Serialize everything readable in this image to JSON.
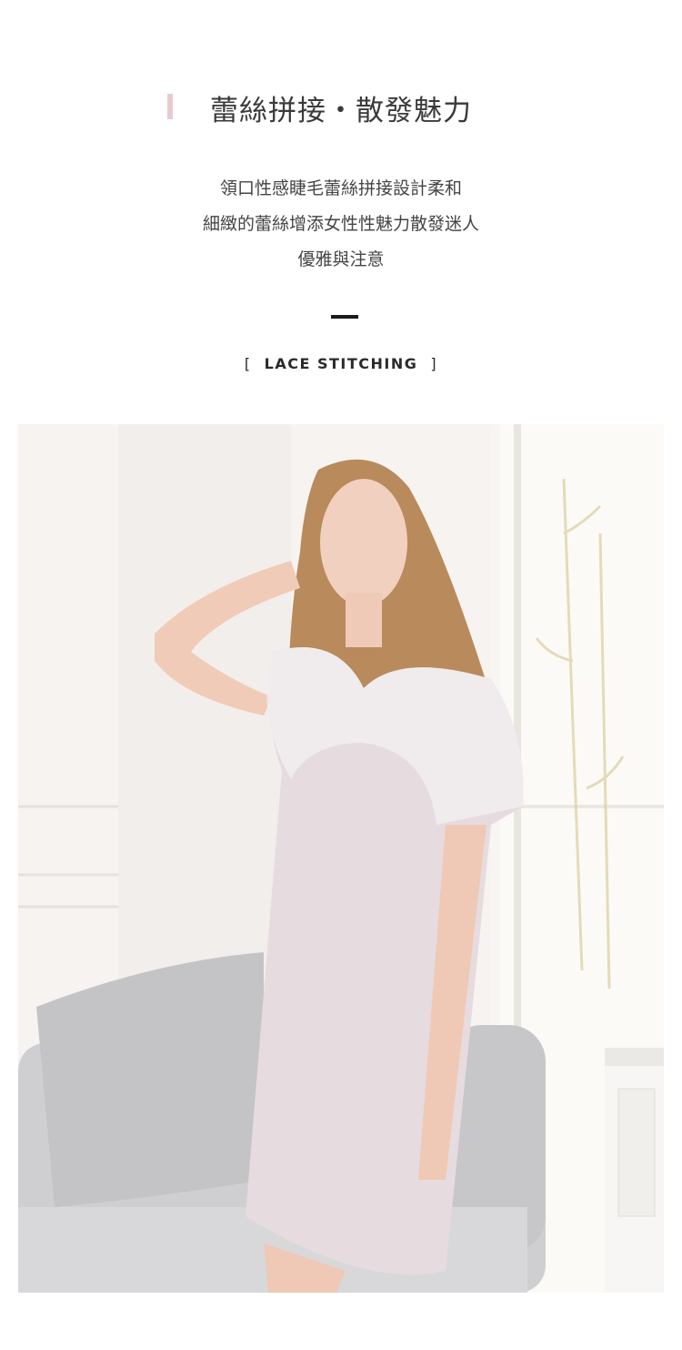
{
  "section": {
    "title": "蕾絲拼接・散發魅力",
    "description_lines": [
      "領口性感睫毛蕾絲拼接設計柔和",
      "細緻的蕾絲增添女性性魅力散發迷人",
      "優雅與注意"
    ],
    "subtitle_open": "[",
    "subtitle": "LACE STITCHING",
    "subtitle_close": "]"
  },
  "colors": {
    "accent": "#e8cbcf",
    "divider": "#1a1a1a",
    "dress": "#e6dcdf",
    "sofa": "#cfcfd1"
  }
}
